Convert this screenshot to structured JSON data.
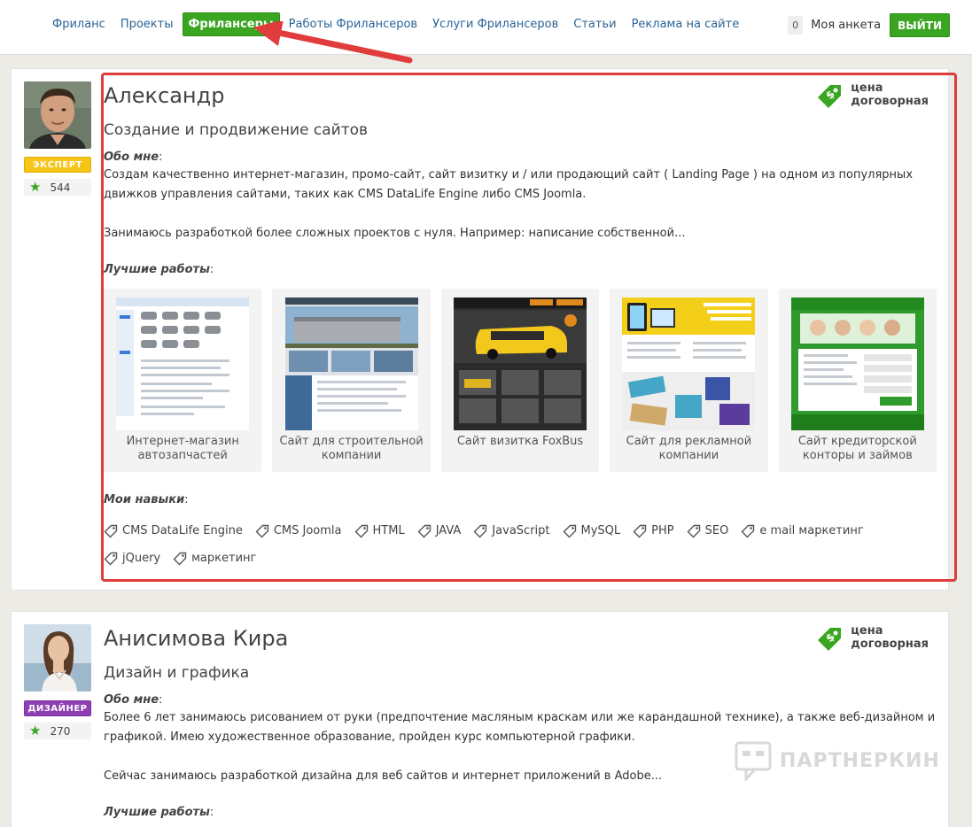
{
  "nav": {
    "items": [
      {
        "label": "Фриланс"
      },
      {
        "label": "Проекты"
      },
      {
        "label": "Фрилансеры"
      },
      {
        "label": "Работы Фрилансеров"
      },
      {
        "label": "Услуги Фрилансеров"
      },
      {
        "label": "Статьи"
      },
      {
        "label": "Реклама на сайте"
      }
    ],
    "active_item": "Фрилансеры",
    "notification_count": "0",
    "my_profile": "Моя анкета",
    "logout": "ВЫЙТИ"
  },
  "freelancers": [
    {
      "name": "Александр",
      "specialty": "Создание и продвижение сайтов",
      "badge": "ЭКСПЕРТ",
      "rating": "544",
      "price_line1": "цена",
      "price_line2": "договорная",
      "about_label": "Обо мне",
      "about_p1": "Создам качественно интернет-магазин, промо-сайт, сайт визитку и / или продающий сайт ( Landing Page ) на одном из популярных движков управления сайтами, таких как CMS DataLife Engine либо CMS Joomla.",
      "about_p2": "Занимаюсь разработкой более сложных проектов с нуля. Например: написание собственной...",
      "works_label": "Лучшие работы",
      "works": [
        {
          "title": "Интернет-магазин автозапчастей"
        },
        {
          "title": "Сайт для строительной компании"
        },
        {
          "title": "Сайт визитка FoxBus"
        },
        {
          "title": "Сайт для рекламной компании"
        },
        {
          "title": "Сайт кредиторской конторы и займов"
        }
      ],
      "skills_label": "Мои навыки",
      "skills": [
        "CMS DataLife Engine",
        "CMS Joomla",
        "HTML",
        "JAVA",
        "JavaScript",
        "MySQL",
        "PHP",
        "SEO",
        "e mail маркетинг",
        "jQuery",
        "маркетинг"
      ]
    },
    {
      "name": "Анисимова Кира",
      "specialty": "Дизайн и графика",
      "badge": "ДИЗАЙНЕР",
      "rating": "270",
      "price_line1": "цена",
      "price_line2": "договорная",
      "about_label": "Обо мне",
      "about_p1": "Более 6 лет занимаюсь рисованием от руки (предпочтение масляным краскам или же карандашной технике), а также веб-дизайном и графикой. Имею художественное образование, пройден курс компьютерной графики.",
      "about_p2": "Сейчас занимаюсь разработкой дизайна для веб сайтов и интернет приложений в Adobe...",
      "works_label": "Лучшие работы"
    }
  ],
  "watermark": "ПАРТНЕРКИН",
  "colors": {
    "accent_green": "#3aa520",
    "link_blue": "#2a6496",
    "expert_yellow": "#f5c518",
    "designer_purple": "#8e3fb4",
    "annotation_red": "#e03c3c"
  }
}
